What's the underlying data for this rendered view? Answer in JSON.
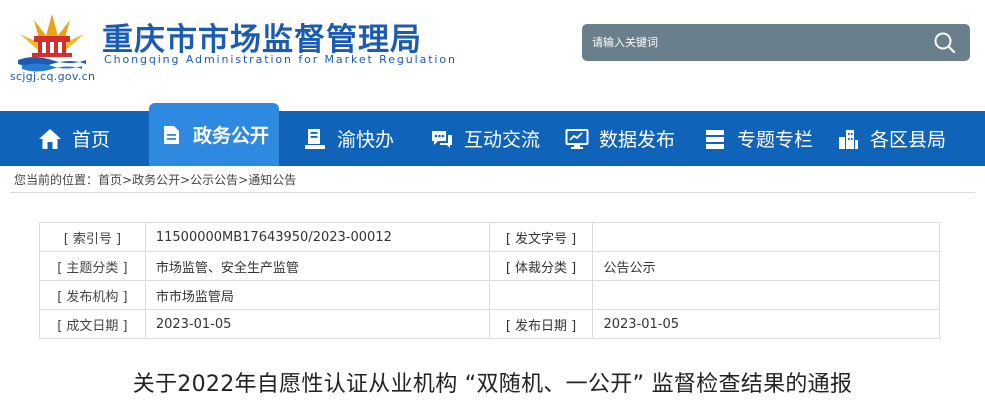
{
  "header": {
    "title": "重庆市市场监督管理局",
    "subtitle": "Chongqing  Administration  for  Market  Regulation",
    "domain": "scjgj.cq.gov.cn",
    "logo_icon": "government-emblem-icon"
  },
  "search": {
    "placeholder": "请输入关键词",
    "icon": "search-icon"
  },
  "nav": {
    "items": [
      {
        "label": "首页",
        "icon": "home-icon"
      },
      {
        "label": "政务公开",
        "icon": "document-icon"
      },
      {
        "label": "渝快办",
        "icon": "service-icon"
      },
      {
        "label": "互动交流",
        "icon": "chat-icon"
      },
      {
        "label": "数据发布",
        "icon": "monitor-chart-icon"
      },
      {
        "label": "专题专栏",
        "icon": "list-icon"
      },
      {
        "label": "各区县局",
        "icon": "building-icon"
      }
    ],
    "active_index": 1
  },
  "breadcrumb": {
    "prefix": "您当前的位置：",
    "items": [
      "首页",
      "政务公开",
      "公示公告",
      "通知公告"
    ],
    "separator": ">"
  },
  "info": {
    "index_no_label": "[ 索引号 ]",
    "index_no": "11500000MB17643950/2023-00012",
    "doc_no_label": "[ 发文字号 ]",
    "doc_no": "",
    "topic_label": "[ 主题分类 ]",
    "topic": "市场监管、安全生产监管",
    "genre_label": "[ 体裁分类 ]",
    "genre": "公告公示",
    "issuer_label": "[ 发布机构 ]",
    "issuer": "市市场监管局",
    "created_label": "[ 成文日期 ]",
    "created": "2023-01-05",
    "published_label": "[ 发布日期 ]",
    "published": "2023-01-05"
  },
  "article": {
    "title": "关于2022年自愿性认证从业机构 “双随机、一公开” 监督检查结果的通报"
  },
  "colors": {
    "nav_bg": "#0f63b8",
    "nav_active": "#2e89e0",
    "brand_blue": "#1b5cb0",
    "search_bg": "#6a7f8c"
  }
}
